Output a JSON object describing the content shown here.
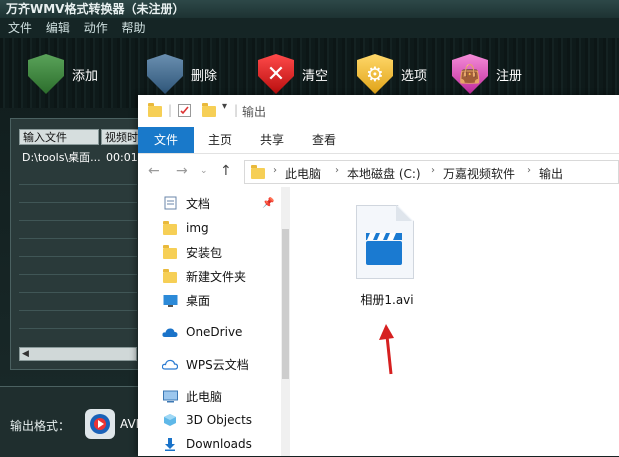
{
  "app": {
    "title": "万齐WMV格式转换器（未注册）",
    "menu": [
      "文件",
      "编辑",
      "动作",
      "帮助"
    ],
    "toolbar": [
      {
        "label": "添加",
        "icon": "add-shield-icon"
      },
      {
        "label": "删除",
        "icon": "delete-shield-icon"
      },
      {
        "label": "清空",
        "icon": "clear-x-icon"
      },
      {
        "label": "选项",
        "icon": "gears-icon"
      },
      {
        "label": "注册",
        "icon": "shopping-bag-icon"
      }
    ],
    "columns": [
      "输入文件",
      "视频时"
    ],
    "row": {
      "file": "D:\\tools\\桌面...",
      "time": "00:01:"
    },
    "output_label": "输出格式：",
    "output_value": "AVI",
    "colors": {
      "accent": "#1979ca"
    }
  },
  "explorer": {
    "title": "输出",
    "ribbon_tabs": [
      "文件",
      "主页",
      "共享",
      "查看"
    ],
    "breadcrumb": [
      "此电脑",
      "本地磁盘 (C:)",
      "万嘉视频软件",
      "输出"
    ],
    "nav_items": [
      {
        "label": "文档",
        "icon": "documents-icon",
        "pinned": true
      },
      {
        "label": "img",
        "icon": "folder-icon"
      },
      {
        "label": "安装包",
        "icon": "folder-icon"
      },
      {
        "label": "新建文件夹",
        "icon": "folder-icon"
      },
      {
        "label": "桌面",
        "icon": "desktop-icon"
      },
      {
        "label": "OneDrive",
        "icon": "onedrive-icon"
      },
      {
        "label": "WPS云文档",
        "icon": "wps-cloud-icon"
      },
      {
        "label": "此电脑",
        "icon": "this-pc-icon"
      },
      {
        "label": "3D Objects",
        "icon": "3d-objects-icon"
      },
      {
        "label": "Downloads",
        "icon": "downloads-icon"
      }
    ],
    "file": {
      "name": "相册1.avi",
      "icon": "video-file-icon"
    }
  },
  "annotation": {
    "color": "#d62020"
  }
}
